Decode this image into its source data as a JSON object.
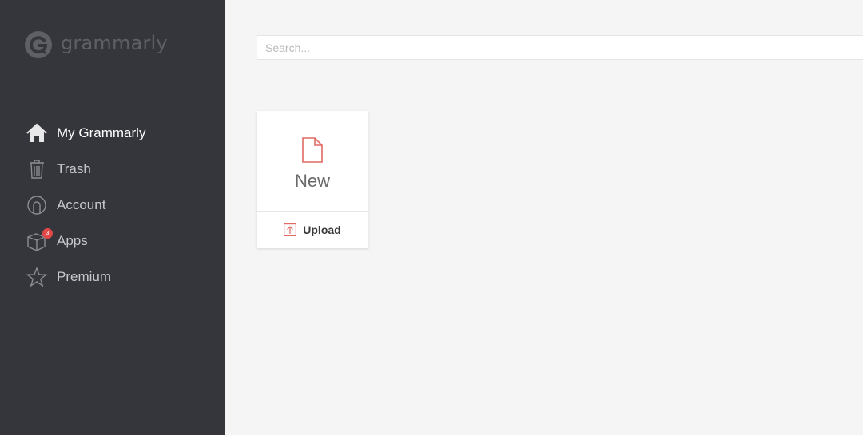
{
  "brand": {
    "name": "grammarly",
    "accent": "#e06a62"
  },
  "sidebar": {
    "items": [
      {
        "label": "My Grammarly",
        "icon": "home-icon",
        "active": true
      },
      {
        "label": "Trash",
        "icon": "trash-icon"
      },
      {
        "label": "Account",
        "icon": "account-icon"
      },
      {
        "label": "Apps",
        "icon": "apps-box-icon",
        "badge": "3"
      },
      {
        "label": "Premium",
        "icon": "star-icon"
      }
    ]
  },
  "search": {
    "placeholder": "Search...",
    "value": ""
  },
  "new_card": {
    "new_label": "New",
    "upload_label": "Upload"
  }
}
